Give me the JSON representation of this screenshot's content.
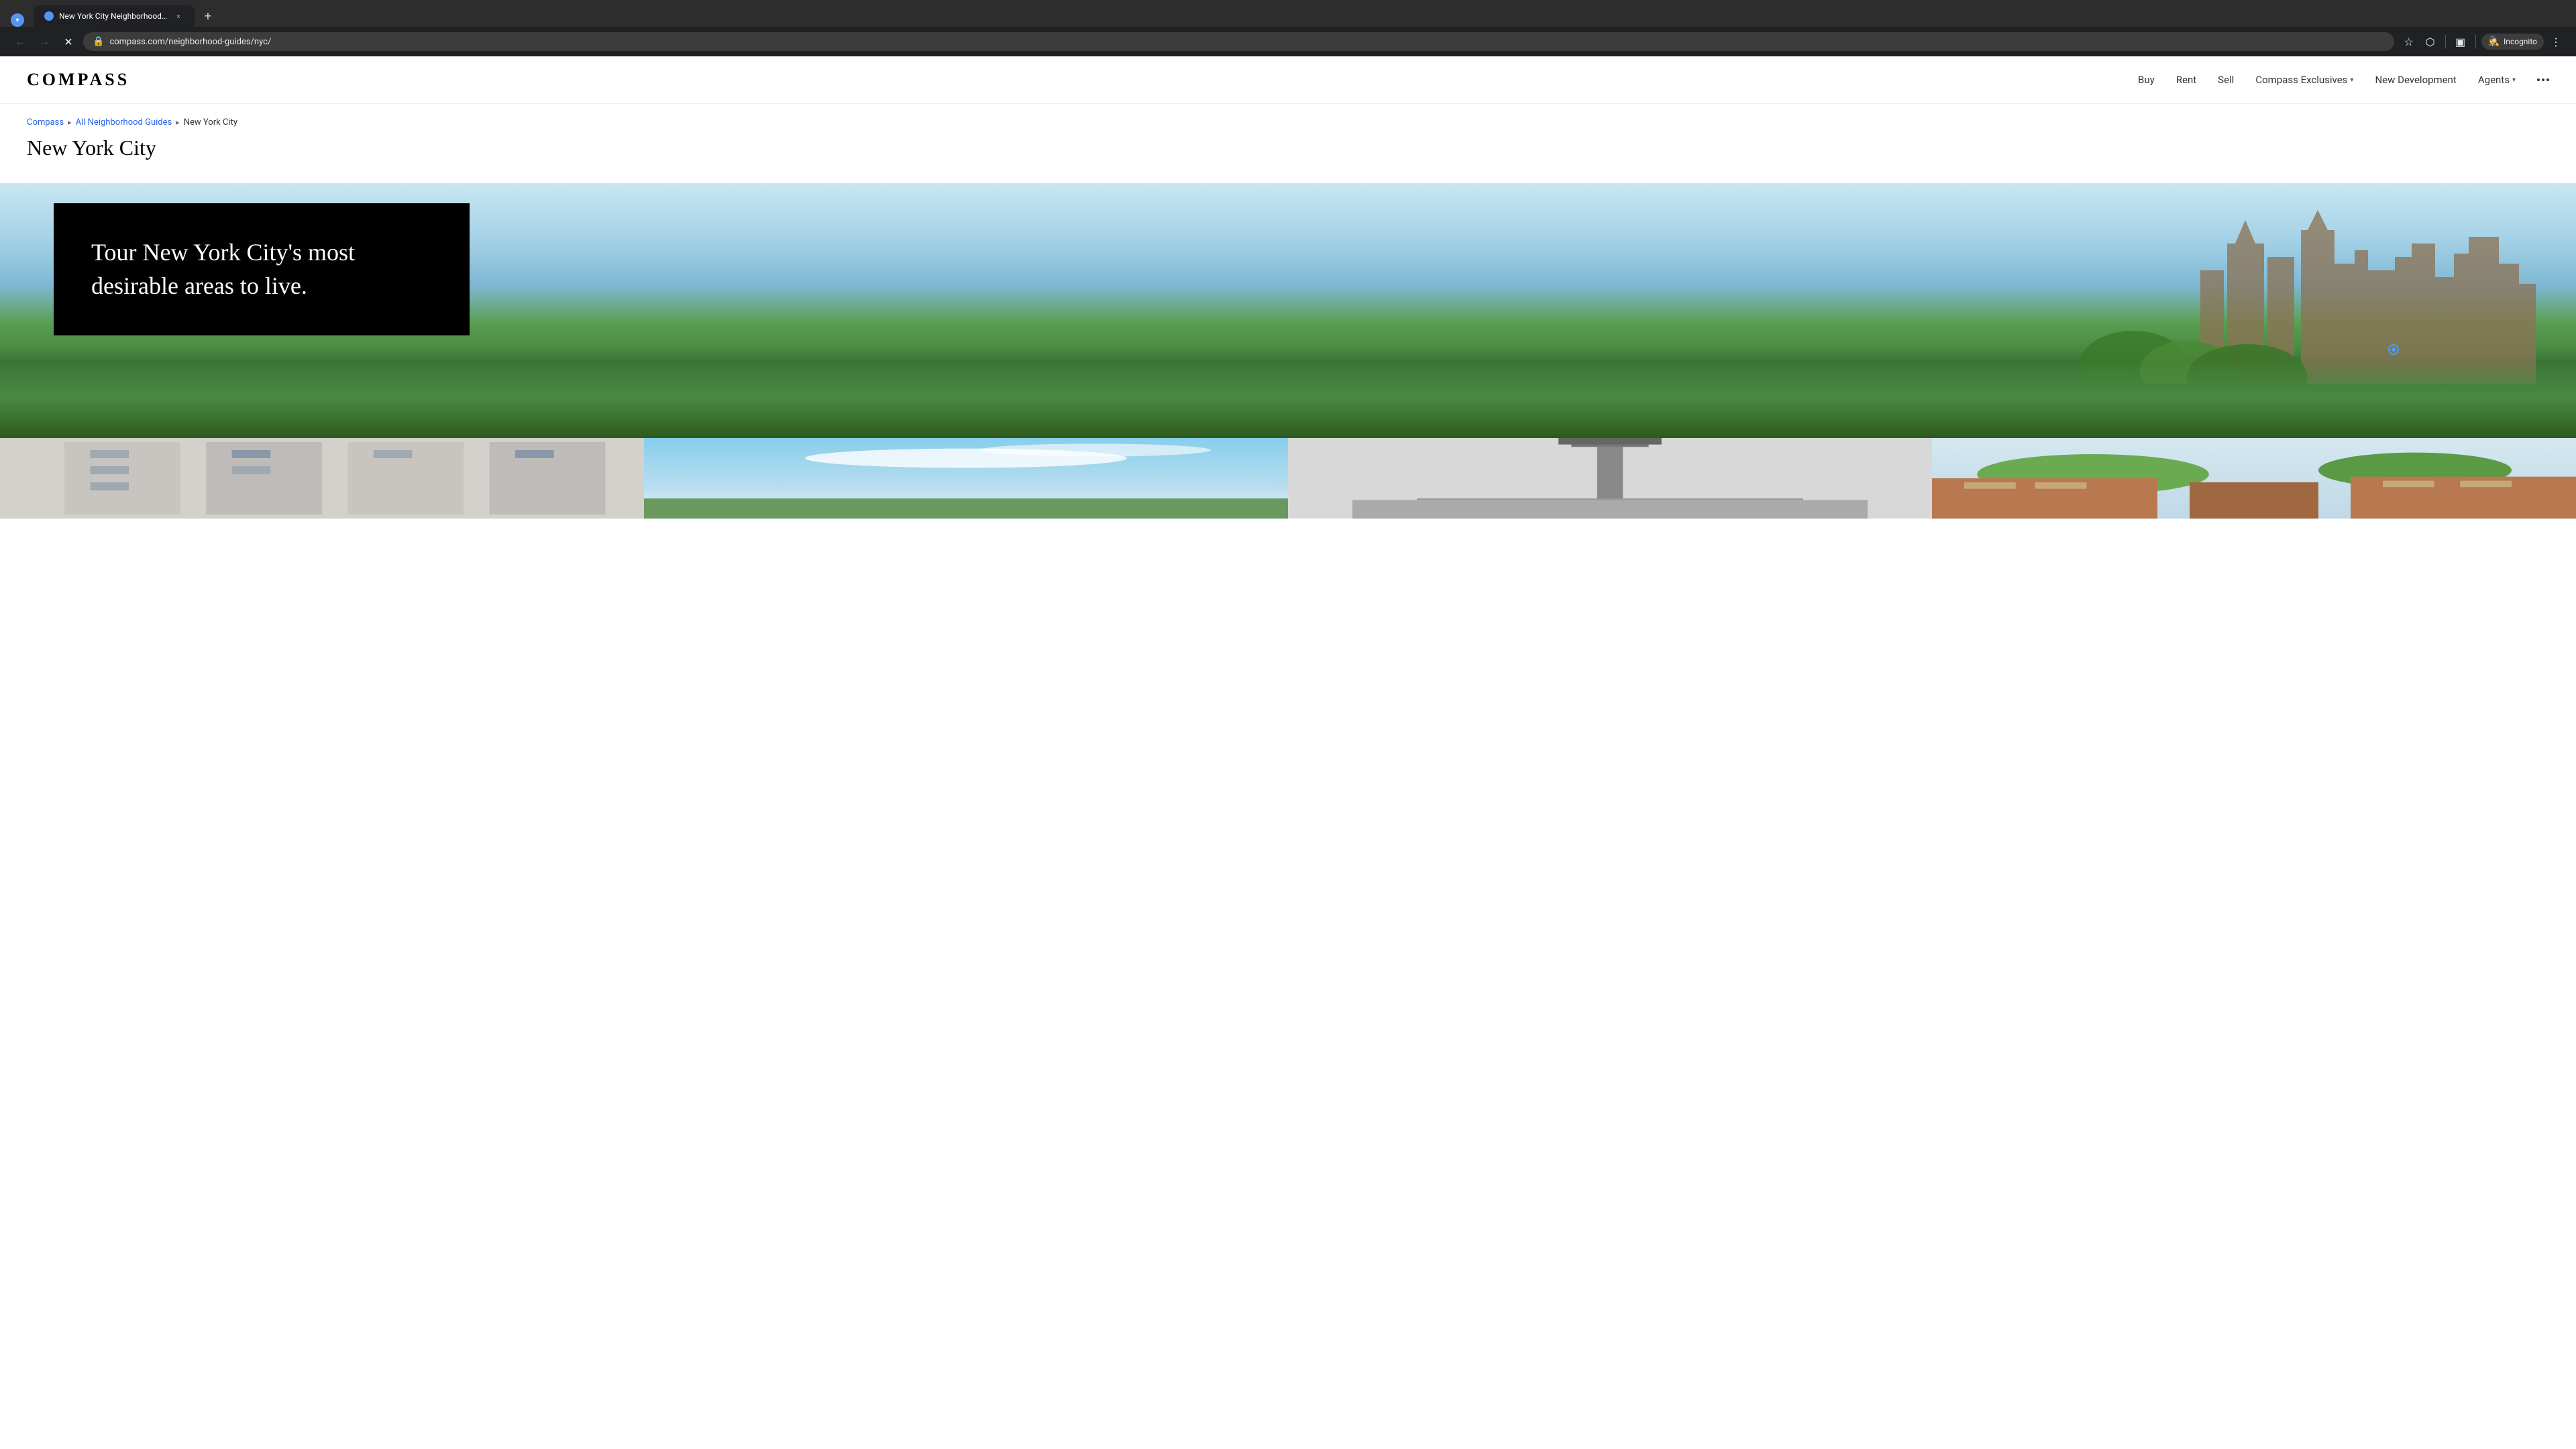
{
  "browser": {
    "tab": {
      "favicon_color": "#5595ee",
      "title": "New York City Neighborhood G...",
      "close_icon": "×"
    },
    "new_tab_icon": "+",
    "navigation": {
      "back_disabled": true,
      "forward_disabled": true,
      "reload_label": "✕",
      "url": "compass.com/neighborhood-guides/nyc/",
      "bookmark_icon": "☆",
      "extensions_icon": "⬡",
      "layout_icon": "▣",
      "incognito_label": "Incognito",
      "menu_icon": "⋮"
    }
  },
  "site": {
    "logo": "COMPASS",
    "nav": {
      "items": [
        {
          "label": "Buy",
          "has_dropdown": false
        },
        {
          "label": "Rent",
          "has_dropdown": false
        },
        {
          "label": "Sell",
          "has_dropdown": false
        },
        {
          "label": "Compass Exclusives",
          "has_dropdown": true
        },
        {
          "label": "New Development",
          "has_dropdown": false
        },
        {
          "label": "Agents",
          "has_dropdown": true
        }
      ]
    }
  },
  "breadcrumb": {
    "home": "Compass",
    "parent": "All Neighborhood Guides",
    "current": "New York City",
    "arrow": "▸"
  },
  "page": {
    "title": "New York City"
  },
  "hero": {
    "text": "Tour New York City's most desirable areas to live."
  },
  "thumbnails": [
    {
      "id": 1,
      "alt": "NYC building exterior"
    },
    {
      "id": 2,
      "alt": "NYC skyline blue sky"
    },
    {
      "id": 3,
      "alt": "NYC street lamp"
    },
    {
      "id": 4,
      "alt": "NYC brownstone street"
    }
  ]
}
